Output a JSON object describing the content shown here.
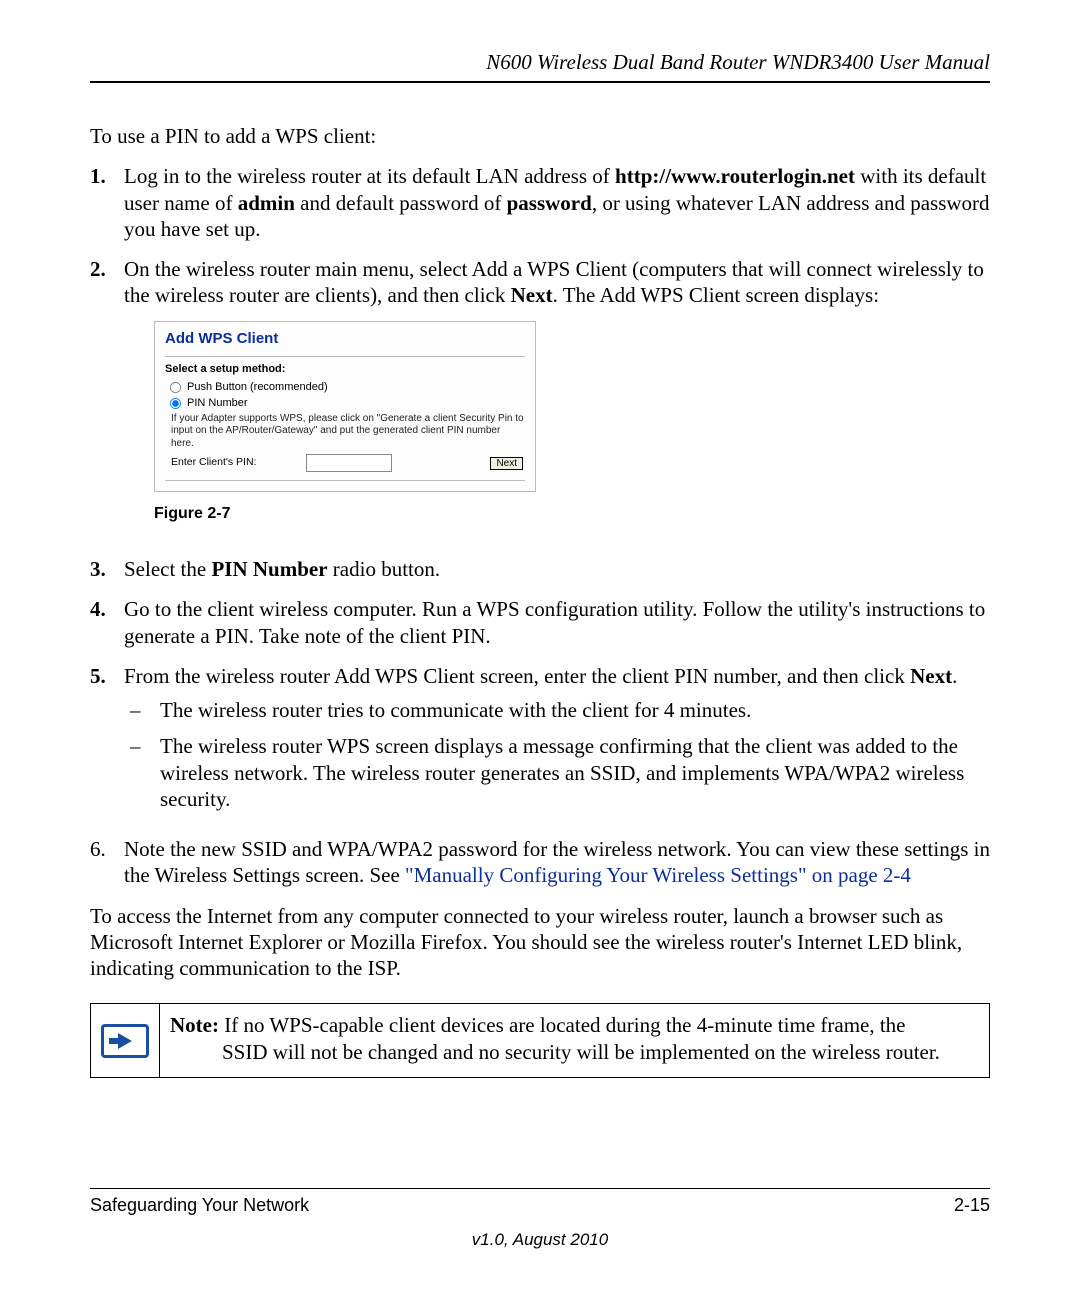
{
  "header": {
    "title": "N600 Wireless Dual Band Router WNDR3400 User Manual"
  },
  "intro": "To use a PIN to add a WPS client:",
  "step1": {
    "num": "1.",
    "t1": "Log in to the wireless router at its default LAN address of ",
    "url": "http://www.routerlogin.net",
    "t2": " with its default user name of ",
    "admin": "admin",
    "t3": " and default password of ",
    "password": "password",
    "t4": ", or using whatever LAN address and password you have set up."
  },
  "step2": {
    "num": "2.",
    "t1": "On the wireless router main menu, select Add a WPS Client (computers that will connect wirelessly to the wireless router are clients), and then click ",
    "next": "Next",
    "t2": ". The Add WPS Client screen displays:"
  },
  "screenshot": {
    "title": "Add WPS Client",
    "select_label": "Select a setup method:",
    "radio_push": "Push Button (recommended)",
    "radio_pin": "PIN Number",
    "help_text": "If your Adapter supports WPS, please click on \"Generate a client Security Pin to input on the AP/Router/Gateway\" and put the generated client PIN number here.",
    "enter_pin_label": "Enter Client's PIN:",
    "next_btn": "Next"
  },
  "figure_caption": "Figure 2-7",
  "step3": {
    "num": "3.",
    "t1": "Select the ",
    "pin_number": "PIN Number",
    "t2": " radio button."
  },
  "step4": {
    "num": "4.",
    "text": "Go to the client wireless computer. Run a WPS configuration utility. Follow the utility's instructions to generate a PIN. Take note of the client PIN."
  },
  "step5": {
    "num": "5.",
    "t1": "From the wireless router Add WPS Client screen, enter the client PIN number, and then click ",
    "next": "Next",
    "t2": ".",
    "b1": "The wireless router tries to communicate with the client for 4 minutes.",
    "b2": "The wireless router WPS screen displays a message confirming that the client was added to the wireless network. The wireless router generates an SSID, and implements WPA/WPA2 wireless security."
  },
  "step6": {
    "num": "6.",
    "t1": "Note the new SSID and WPA/WPA2 password for the wireless network. You can view these settings in the Wireless Settings screen. See ",
    "link": "\"Manually Configuring Your Wireless Settings\" on page 2-4"
  },
  "access_para": "To access the Internet from any computer connected to your wireless router, launch a browser such as Microsoft Internet Explorer or Mozilla Firefox. You should see the wireless router's Internet LED blink, indicating communication to the ISP.",
  "note": {
    "label": "Note:",
    "line1_rest": " If no WPS-capable client devices are located during the 4-minute time frame, the",
    "line2": "SSID will not be changed and no security will be implemented on the wireless router."
  },
  "footer": {
    "left": "Safeguarding Your Network",
    "right": "2-15",
    "version": "v1.0, August 2010"
  }
}
